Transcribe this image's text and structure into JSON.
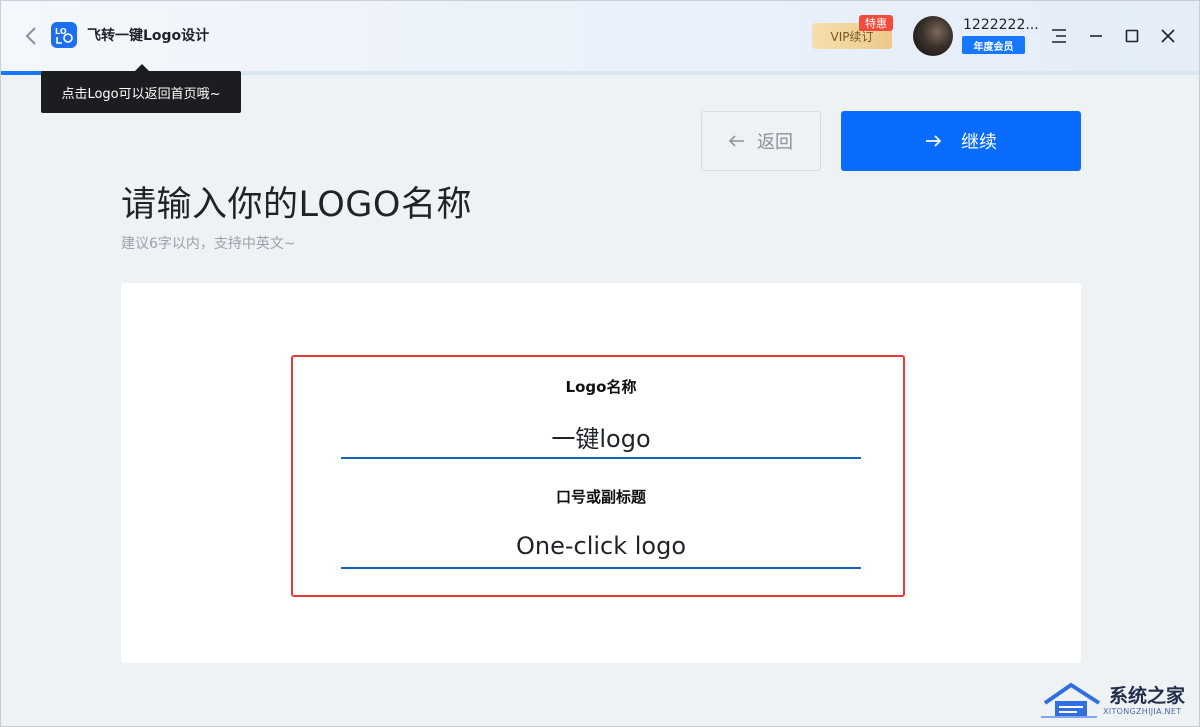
{
  "titlebar": {
    "app_title": "飞转一键Logo设计",
    "app_logo_text": "LOGO",
    "tooltip": "点击Logo可以返回首页哦~",
    "progress_fraction": 0.11,
    "vip_label": "VIP续订",
    "vip_badge": "特惠",
    "username": "1222222...",
    "member_badge": "年度会员",
    "accent_color": "#1677ff"
  },
  "nav": {
    "back_label": "返回",
    "continue_label": "继续"
  },
  "main": {
    "title": "请输入你的LOGO名称",
    "subtitle": "建议6字以内，支持中英文~",
    "fields": [
      {
        "label": "Logo名称",
        "value": "一键logo"
      },
      {
        "label": "口号或副标题",
        "value": "One-click logo"
      }
    ]
  },
  "watermark": {
    "text": "系统之家",
    "sub": "XITONGZHIJIA.NET"
  }
}
